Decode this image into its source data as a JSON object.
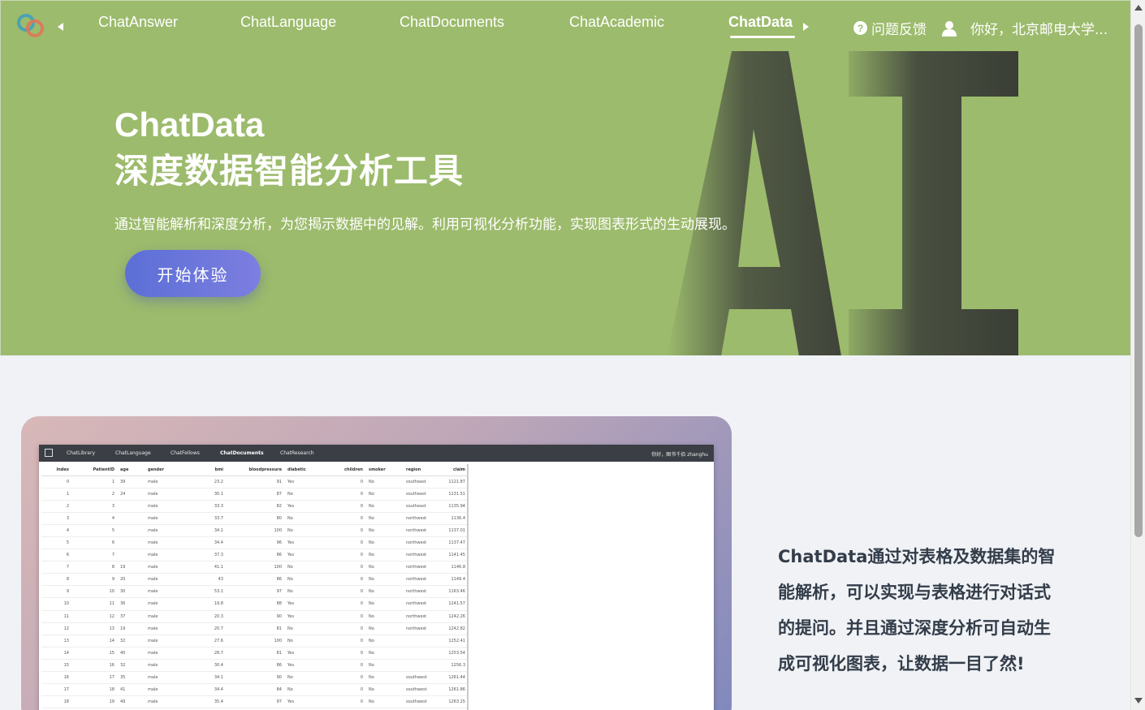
{
  "nav": {
    "tabs": [
      {
        "label": "ChatAnswer",
        "active": false
      },
      {
        "label": "ChatLanguage",
        "active": false
      },
      {
        "label": "ChatDocuments",
        "active": false
      },
      {
        "label": "ChatAcademic",
        "active": false
      },
      {
        "label": "ChatData",
        "active": true
      }
    ],
    "feedback_label": "问题反馈",
    "feedback_icon": "question-circle-icon",
    "user_label": "你好，北京邮电大学...",
    "user_icon": "user-icon"
  },
  "hero": {
    "title": "ChatData",
    "subtitle": "深度数据智能分析工具",
    "description": "通过智能解析和深度分析，为您揭示数据中的见解。利用可视化分析功能，实现图表形式的生动展现。",
    "cta_label": "开始体验",
    "art_text": "AI",
    "bg_color": "#9cbb6c",
    "cta_color": "#5b6fd6"
  },
  "feature": {
    "text": "ChatData通过对表格及数据集的智能解析，可以实现与表格进行对话式的提问。并且通过深度分析可自动生成可视化图表，让数据一目了然!"
  },
  "mock_app": {
    "tabs": [
      "ChatLibrary",
      "ChatLanguage",
      "ChatFellows",
      "ChatDocuments",
      "ChatResearch"
    ],
    "active_tab": "ChatDocuments",
    "user_label": "你好，图书千佰 zhanghu",
    "columns": [
      "index",
      "PatientID",
      "age",
      "gender",
      "bmi",
      "bloodpressure",
      "diabetic",
      "children",
      "smoker",
      "region",
      "claim"
    ],
    "rows": [
      [
        "0",
        "1",
        "39",
        "male",
        "23.2",
        "91",
        "Yes",
        "0",
        "No",
        "southeast",
        "1121.87"
      ],
      [
        "1",
        "2",
        "24",
        "male",
        "30.1",
        "87",
        "No",
        "0",
        "No",
        "southeast",
        "1131.51"
      ],
      [
        "2",
        "3",
        "",
        "male",
        "33.3",
        "82",
        "Yes",
        "0",
        "No",
        "southeast",
        "1135.94"
      ],
      [
        "3",
        "4",
        "",
        "male",
        "33.7",
        "80",
        "No",
        "0",
        "No",
        "northwest",
        "1136.4"
      ],
      [
        "4",
        "5",
        "",
        "male",
        "34.1",
        "100",
        "No",
        "0",
        "No",
        "northwest",
        "1137.01"
      ],
      [
        "5",
        "6",
        "",
        "male",
        "34.4",
        "96",
        "Yes",
        "0",
        "No",
        "northwest",
        "1137.47"
      ],
      [
        "6",
        "7",
        "",
        "male",
        "37.3",
        "86",
        "Yes",
        "0",
        "No",
        "northwest",
        "1141.45"
      ],
      [
        "7",
        "8",
        "19",
        "male",
        "41.1",
        "100",
        "No",
        "0",
        "No",
        "northwest",
        "1146.8"
      ],
      [
        "8",
        "9",
        "20",
        "male",
        "43",
        "86",
        "No",
        "0",
        "No",
        "northwest",
        "1149.4"
      ],
      [
        "9",
        "10",
        "30",
        "male",
        "53.1",
        "97",
        "No",
        "0",
        "No",
        "northwest",
        "1163.46"
      ],
      [
        "10",
        "11",
        "36",
        "male",
        "19.8",
        "88",
        "Yes",
        "0",
        "No",
        "northwest",
        "1241.57"
      ],
      [
        "11",
        "12",
        "37",
        "male",
        "20.3",
        "90",
        "Yes",
        "0",
        "No",
        "northwest",
        "1242.26"
      ],
      [
        "12",
        "13",
        "19",
        "male",
        "20.7",
        "81",
        "No",
        "0",
        "No",
        "northwest",
        "1242.82"
      ],
      [
        "13",
        "14",
        "32",
        "male",
        "27.6",
        "100",
        "No",
        "0",
        "No",
        "",
        "1252.41"
      ],
      [
        "14",
        "15",
        "40",
        "male",
        "28.7",
        "81",
        "Yes",
        "0",
        "No",
        "",
        "1253.54"
      ],
      [
        "15",
        "16",
        "32",
        "male",
        "30.4",
        "86",
        "Yes",
        "0",
        "No",
        "",
        "1256.3"
      ],
      [
        "16",
        "17",
        "35",
        "male",
        "34.1",
        "90",
        "No",
        "0",
        "No",
        "southwest",
        "1261.44"
      ],
      [
        "17",
        "18",
        "41",
        "male",
        "34.4",
        "84",
        "No",
        "0",
        "No",
        "southwest",
        "1261.86"
      ],
      [
        "18",
        "19",
        "49",
        "male",
        "35.4",
        "97",
        "Yes",
        "0",
        "No",
        "southwest",
        "1263.25"
      ]
    ]
  }
}
